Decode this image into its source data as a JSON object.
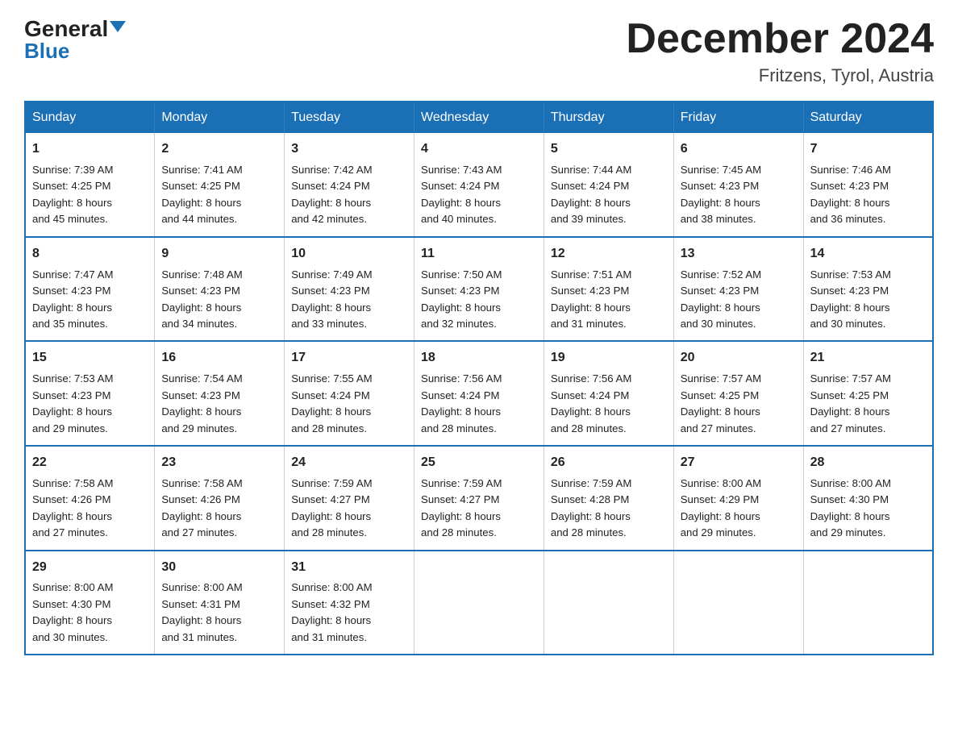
{
  "header": {
    "logo_general": "General",
    "logo_blue": "Blue",
    "month_title": "December 2024",
    "location": "Fritzens, Tyrol, Austria"
  },
  "days_of_week": [
    "Sunday",
    "Monday",
    "Tuesday",
    "Wednesday",
    "Thursday",
    "Friday",
    "Saturday"
  ],
  "weeks": [
    [
      {
        "day": "1",
        "sunrise": "7:39 AM",
        "sunset": "4:25 PM",
        "daylight": "8 hours and 45 minutes."
      },
      {
        "day": "2",
        "sunrise": "7:41 AM",
        "sunset": "4:25 PM",
        "daylight": "8 hours and 44 minutes."
      },
      {
        "day": "3",
        "sunrise": "7:42 AM",
        "sunset": "4:24 PM",
        "daylight": "8 hours and 42 minutes."
      },
      {
        "day": "4",
        "sunrise": "7:43 AM",
        "sunset": "4:24 PM",
        "daylight": "8 hours and 40 minutes."
      },
      {
        "day": "5",
        "sunrise": "7:44 AM",
        "sunset": "4:24 PM",
        "daylight": "8 hours and 39 minutes."
      },
      {
        "day": "6",
        "sunrise": "7:45 AM",
        "sunset": "4:23 PM",
        "daylight": "8 hours and 38 minutes."
      },
      {
        "day": "7",
        "sunrise": "7:46 AM",
        "sunset": "4:23 PM",
        "daylight": "8 hours and 36 minutes."
      }
    ],
    [
      {
        "day": "8",
        "sunrise": "7:47 AM",
        "sunset": "4:23 PM",
        "daylight": "8 hours and 35 minutes."
      },
      {
        "day": "9",
        "sunrise": "7:48 AM",
        "sunset": "4:23 PM",
        "daylight": "8 hours and 34 minutes."
      },
      {
        "day": "10",
        "sunrise": "7:49 AM",
        "sunset": "4:23 PM",
        "daylight": "8 hours and 33 minutes."
      },
      {
        "day": "11",
        "sunrise": "7:50 AM",
        "sunset": "4:23 PM",
        "daylight": "8 hours and 32 minutes."
      },
      {
        "day": "12",
        "sunrise": "7:51 AM",
        "sunset": "4:23 PM",
        "daylight": "8 hours and 31 minutes."
      },
      {
        "day": "13",
        "sunrise": "7:52 AM",
        "sunset": "4:23 PM",
        "daylight": "8 hours and 30 minutes."
      },
      {
        "day": "14",
        "sunrise": "7:53 AM",
        "sunset": "4:23 PM",
        "daylight": "8 hours and 30 minutes."
      }
    ],
    [
      {
        "day": "15",
        "sunrise": "7:53 AM",
        "sunset": "4:23 PM",
        "daylight": "8 hours and 29 minutes."
      },
      {
        "day": "16",
        "sunrise": "7:54 AM",
        "sunset": "4:23 PM",
        "daylight": "8 hours and 29 minutes."
      },
      {
        "day": "17",
        "sunrise": "7:55 AM",
        "sunset": "4:24 PM",
        "daylight": "8 hours and 28 minutes."
      },
      {
        "day": "18",
        "sunrise": "7:56 AM",
        "sunset": "4:24 PM",
        "daylight": "8 hours and 28 minutes."
      },
      {
        "day": "19",
        "sunrise": "7:56 AM",
        "sunset": "4:24 PM",
        "daylight": "8 hours and 28 minutes."
      },
      {
        "day": "20",
        "sunrise": "7:57 AM",
        "sunset": "4:25 PM",
        "daylight": "8 hours and 27 minutes."
      },
      {
        "day": "21",
        "sunrise": "7:57 AM",
        "sunset": "4:25 PM",
        "daylight": "8 hours and 27 minutes."
      }
    ],
    [
      {
        "day": "22",
        "sunrise": "7:58 AM",
        "sunset": "4:26 PM",
        "daylight": "8 hours and 27 minutes."
      },
      {
        "day": "23",
        "sunrise": "7:58 AM",
        "sunset": "4:26 PM",
        "daylight": "8 hours and 27 minutes."
      },
      {
        "day": "24",
        "sunrise": "7:59 AM",
        "sunset": "4:27 PM",
        "daylight": "8 hours and 28 minutes."
      },
      {
        "day": "25",
        "sunrise": "7:59 AM",
        "sunset": "4:27 PM",
        "daylight": "8 hours and 28 minutes."
      },
      {
        "day": "26",
        "sunrise": "7:59 AM",
        "sunset": "4:28 PM",
        "daylight": "8 hours and 28 minutes."
      },
      {
        "day": "27",
        "sunrise": "8:00 AM",
        "sunset": "4:29 PM",
        "daylight": "8 hours and 29 minutes."
      },
      {
        "day": "28",
        "sunrise": "8:00 AM",
        "sunset": "4:30 PM",
        "daylight": "8 hours and 29 minutes."
      }
    ],
    [
      {
        "day": "29",
        "sunrise": "8:00 AM",
        "sunset": "4:30 PM",
        "daylight": "8 hours and 30 minutes."
      },
      {
        "day": "30",
        "sunrise": "8:00 AM",
        "sunset": "4:31 PM",
        "daylight": "8 hours and 31 minutes."
      },
      {
        "day": "31",
        "sunrise": "8:00 AM",
        "sunset": "4:32 PM",
        "daylight": "8 hours and 31 minutes."
      },
      null,
      null,
      null,
      null
    ]
  ],
  "labels": {
    "sunrise": "Sunrise:",
    "sunset": "Sunset:",
    "daylight": "Daylight:"
  }
}
